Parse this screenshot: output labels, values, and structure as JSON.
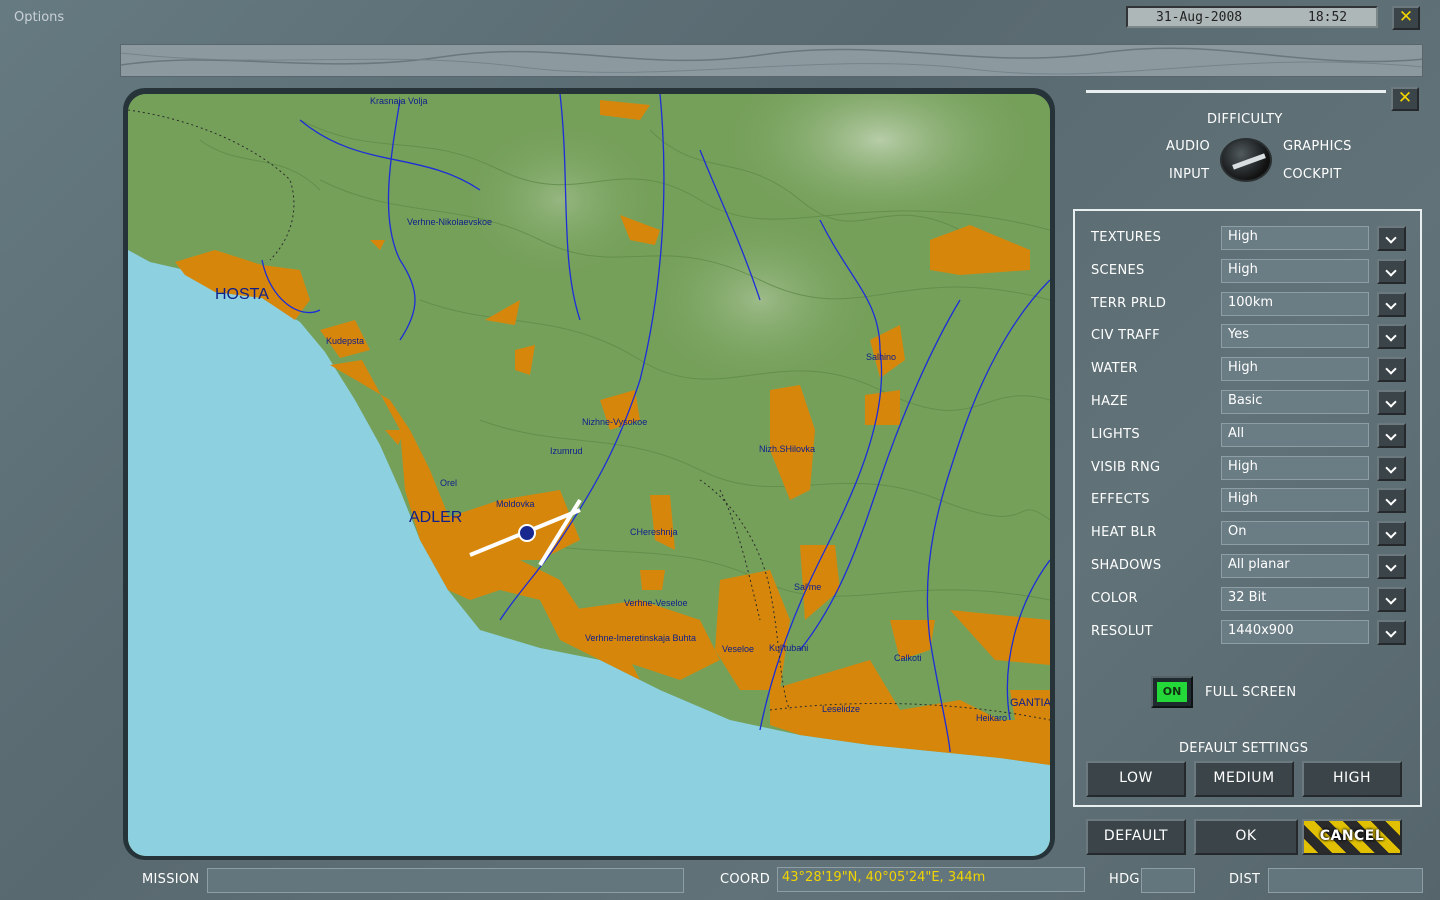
{
  "window": {
    "title": "Options",
    "date": "31-Aug-2008",
    "time": "18:52",
    "close_glyph": "✕"
  },
  "map": {
    "places": [
      {
        "name": "Krasnaja Volja"
      },
      {
        "name": "Verhne-Nikolaevskoe"
      },
      {
        "name": "HOSTA"
      },
      {
        "name": "Kudepsta"
      },
      {
        "name": "Nizhne-Vysokoe"
      },
      {
        "name": "Izumrud"
      },
      {
        "name": "Orel"
      },
      {
        "name": "Moldovka"
      },
      {
        "name": "ADLER"
      },
      {
        "name": "CHereshnja"
      },
      {
        "name": "Nizh.SHilovka"
      },
      {
        "name": "Salhino"
      },
      {
        "name": "Sal'me"
      },
      {
        "name": "Verhne-Veseloe"
      },
      {
        "name": "Verhne-Imeretinskaja Buhta"
      },
      {
        "name": "Veseloe"
      },
      {
        "name": "Kul'tubani"
      },
      {
        "name": "Calkoti"
      },
      {
        "name": "Leselidze"
      },
      {
        "name": "Heikaro"
      },
      {
        "name": "GANTIA"
      }
    ]
  },
  "options_panel": {
    "close_glyph": "✕",
    "categories": {
      "top": "DIFFICULTY",
      "left_top": "AUDIO",
      "right_top": "GRAPHICS",
      "left_bottom": "INPUT",
      "right_bottom": "COCKPIT"
    },
    "settings": [
      {
        "label": "TEXTURES",
        "value": "High"
      },
      {
        "label": "SCENES",
        "value": "High"
      },
      {
        "label": "TERR PRLD",
        "value": "100km"
      },
      {
        "label": "CIV TRAFF",
        "value": "Yes"
      },
      {
        "label": "WATER",
        "value": "High"
      },
      {
        "label": "HAZE",
        "value": "Basic"
      },
      {
        "label": "LIGHTS",
        "value": "All"
      },
      {
        "label": "VISIB RNG",
        "value": "High"
      },
      {
        "label": "EFFECTS",
        "value": "High"
      },
      {
        "label": "HEAT BLR",
        "value": "On"
      },
      {
        "label": "SHADOWS",
        "value": "All planar"
      },
      {
        "label": "COLOR",
        "value": "32 Bit"
      },
      {
        "label": "RESOLUT",
        "value": "1440x900"
      }
    ],
    "fullscreen": {
      "toggle": "ON",
      "label": "FULL SCREEN"
    },
    "defaults": {
      "title": "DEFAULT SETTINGS",
      "low": "LOW",
      "medium": "MEDIUM",
      "high": "HIGH"
    },
    "actions": {
      "default": "DEFAULT",
      "ok": "OK",
      "cancel": "CANCEL"
    }
  },
  "bottom_bar": {
    "mission_label": "MISSION",
    "mission_value": "",
    "coord_label": "COORD",
    "coord_value": "43°28'19\"N, 40°05'24\"E, 344m",
    "hdg_label": "HDG",
    "hdg_value": "",
    "dist_label": "DIST",
    "dist_value": ""
  }
}
